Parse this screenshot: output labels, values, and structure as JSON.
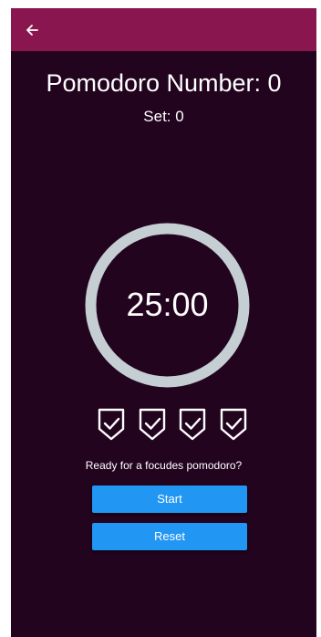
{
  "colors": {
    "app_bar": "#8a164f",
    "background": "#22041f",
    "timer_ring": "#c5ced3",
    "button": "#2196f3",
    "text": "#ffffff"
  },
  "app_bar": {
    "back_icon": "arrow-left-icon"
  },
  "header": {
    "title": "Pomodoro Number: 0",
    "set_label": "Set: 0"
  },
  "timer": {
    "time": "25:00"
  },
  "badges": [
    {
      "icon": "shield-check-icon"
    },
    {
      "icon": "shield-check-icon"
    },
    {
      "icon": "shield-check-icon"
    },
    {
      "icon": "shield-check-icon"
    }
  ],
  "status": {
    "message": "Ready for a focudes pomodoro?"
  },
  "buttons": {
    "start_label": "Start",
    "reset_label": "Reset"
  }
}
